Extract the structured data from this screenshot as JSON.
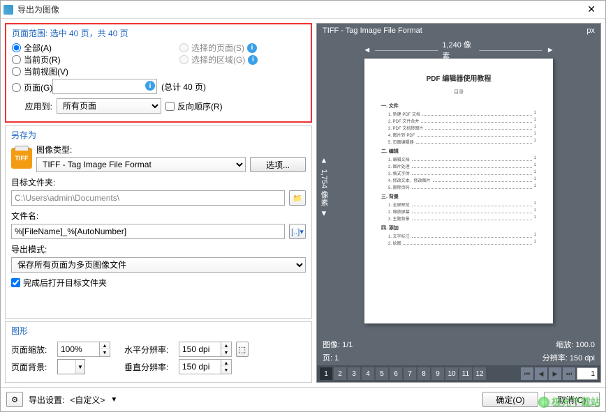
{
  "window": {
    "title": "导出为图像",
    "close": "✕"
  },
  "page_range": {
    "title": "页面范围: 选中 40 页，共 40 页",
    "all": "全部(A)",
    "selected_pages": "选择的页面(S)",
    "current_page": "当前页(R)",
    "selected_area": "选择的区域(G)",
    "current_view": "当前视图(V)",
    "pages": "页面(G)",
    "pages_value": "",
    "total": "(总计 40 页)",
    "apply_to_label": "应用到:",
    "apply_to_value": "所有页面",
    "reverse": "反向顺序(R)"
  },
  "save_as": {
    "title": "另存为",
    "tiff_badge": "TIFF",
    "image_type_label": "图像类型:",
    "image_type_value": "TIFF - Tag Image File Format",
    "options_btn": "选项...",
    "dest_folder_label": "目标文件夹:",
    "dest_folder_value": "C:\\Users\\admin\\Documents\\",
    "filename_label": "文件名:",
    "filename_value": "%[FileName]_%[AutoNumber]",
    "export_mode_label": "导出模式:",
    "export_mode_value": "保存所有页面为多页图像文件",
    "open_after": "完成后打开目标文件夹"
  },
  "graphics": {
    "title": "图形",
    "zoom_label": "页面缩放:",
    "zoom_value": "100%",
    "bg_label": "页面背景:",
    "hres_label": "水平分辨率:",
    "hres_value": "150 dpi",
    "vres_label": "垂直分辨率:",
    "vres_value": "150 dpi"
  },
  "preview": {
    "format": "TIFF - Tag Image File Format",
    "unit": "px",
    "width": "1,240 像素",
    "height": "1,754 像素",
    "doc_title": "PDF 编辑器使用教程",
    "doc_sub": "目录",
    "toc": [
      {
        "sec": "一. 文件",
        "items": [
          "1. 新建 PDF 文档",
          "2. PDF 文件合并",
          "3. PDF 文档转图片",
          "4. 图片转 PDF",
          "5. 页面编辑器"
        ]
      },
      {
        "sec": "二. 编辑",
        "items": [
          "1. 编辑文档",
          "2. 图片处理",
          "3. 格式字体",
          "4. 修改文本，修改图片",
          "5. 删除页码"
        ]
      },
      {
        "sec": "三. 背景",
        "items": [
          "1. 全屏预览",
          "2. 缩放屏幕",
          "3. 主题背景"
        ]
      },
      {
        "sec": "四. 添加",
        "items": [
          "1. 文字标注",
          "2. 绘图"
        ]
      }
    ],
    "image_info": "图像: 1/1",
    "zoom_info": "缩放: 100.0",
    "page_info": "页: 1",
    "dpi_info": "分辨率: 150 dpi",
    "pages": [
      "1",
      "2",
      "3",
      "4",
      "5",
      "6",
      "7",
      "8",
      "9",
      "10",
      "11",
      "12"
    ],
    "page_input": "1"
  },
  "footer": {
    "export_settings_label": "导出设置:",
    "export_settings_value": "<自定义>",
    "ok": "确定(O)",
    "cancel": "取消(C)"
  },
  "watermark": "极光下载站"
}
